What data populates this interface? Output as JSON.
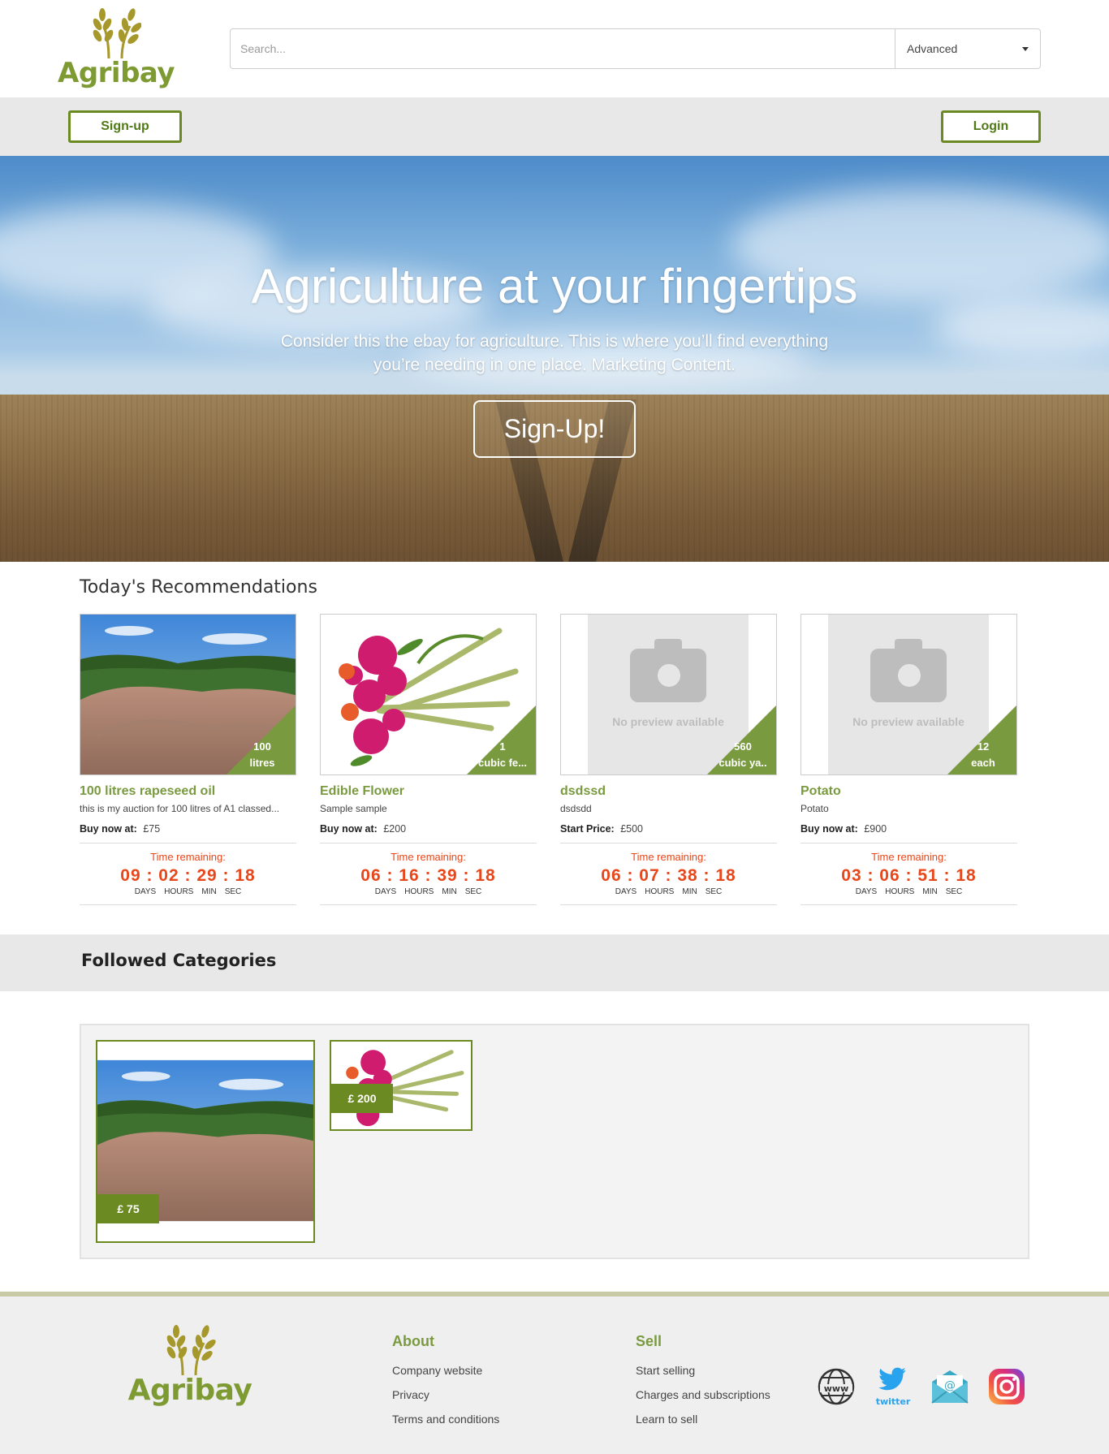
{
  "brand": {
    "name": "Agribay",
    "color": "#7e9a33"
  },
  "search": {
    "placeholder": "Search...",
    "dropdown_selected": "Advanced"
  },
  "nav": {
    "signup_label": "Sign-up",
    "login_label": "Login"
  },
  "hero": {
    "title": "Agriculture at your fingertips",
    "subtitle": "Consider this the ebay for agriculture. This is where you’ll find everything you’re needing in one place. Marketing Content.",
    "cta_label": "Sign-Up!"
  },
  "recommendations": {
    "title": "Today's Recommendations",
    "time_label": "Time remaining:",
    "units": [
      "DAYS",
      "HOURS",
      "MIN",
      "SEC"
    ],
    "items": [
      {
        "qty": "100",
        "unit": "litres",
        "name": "100 litres rapeseed oil",
        "desc": "this is my auction for 100 litres of A1 classed...",
        "price_label": "Buy now at:",
        "price": "£75",
        "timer": "09 : 02 : 29 :  18",
        "image": "landscape-photo"
      },
      {
        "qty": "1",
        "unit": "cubic fe...",
        "name": "Edible Flower",
        "desc": "Sample sample",
        "price_label": "Buy now at:",
        "price": "£200",
        "timer": "06 : 16 : 39 :  18",
        "image": "flower-photo"
      },
      {
        "qty": "560",
        "unit": "cubic ya..",
        "name": "dsdssd",
        "desc": "dsdsdd",
        "price_label": "Start Price:",
        "price": "£500",
        "timer": "06 : 07 : 38 :  18",
        "image": "no-preview"
      },
      {
        "qty": "12",
        "unit": "each",
        "name": "Potato",
        "desc": "Potato",
        "price_label": "Buy now at:",
        "price": "£900",
        "timer": "03 : 06 : 51 :  18",
        "image": "no-preview"
      }
    ],
    "no_preview_text": "No preview available",
    "accent_color": "#7a9a3f",
    "timer_color": "#e8471b"
  },
  "followed": {
    "title": "Followed Categories",
    "items": [
      {
        "price": "£ 75",
        "image": "landscape-photo"
      },
      {
        "price": "£ 200",
        "image": "flower-photo"
      }
    ]
  },
  "footer": {
    "about": {
      "title": "About",
      "links": [
        "Company website",
        "Privacy",
        "Terms and conditions"
      ]
    },
    "sell": {
      "title": "Sell",
      "links": [
        "Start selling",
        "Charges and subscriptions",
        "Learn to sell"
      ]
    },
    "social": [
      "globe-icon",
      "twitter-icon",
      "email-icon",
      "instagram-icon"
    ],
    "twitter_text": "twitter",
    "globe_text": "www"
  }
}
